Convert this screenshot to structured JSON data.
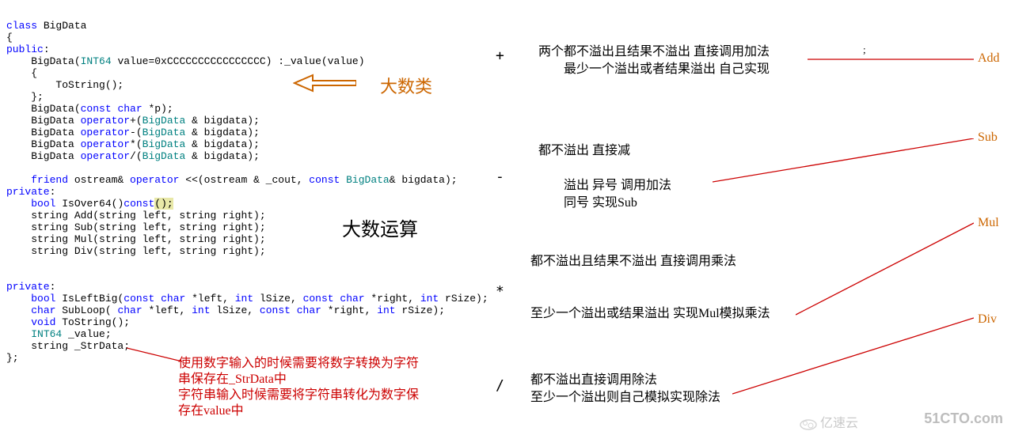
{
  "code": {
    "t01": "class",
    "t02": " BigData",
    "t03": "{",
    "t04": "public",
    "t05": ":",
    "t06": "    BigData(",
    "t07": "INT64",
    "t08": " value=0xCCCCCCCCCCCCCCCC) :_value(value)",
    "t09": "    {",
    "t10": "        ToString();",
    "t11": "    };",
    "t12": "    BigData(",
    "t13": "const",
    "t14": " ",
    "t15": "char",
    "t16": " *p);",
    "t17": "    BigData ",
    "t18": "operator",
    "t19": "+(",
    "t20": "BigData",
    "t21": " & bigdata);",
    "t22": "    BigData ",
    "t23": "operator",
    "t24": "-(",
    "t25": "BigData",
    "t26": " & bigdata);",
    "t27": "    BigData ",
    "t28": "operator",
    "t29": "*(",
    "t30": "BigData",
    "t31": " & bigdata);",
    "t32": "    BigData ",
    "t33": "operator",
    "t34": "/(",
    "t35": "BigData",
    "t36": " & bigdata);",
    "t37": "    ",
    "t38": "friend",
    "t39": " ostream& ",
    "t40": "operator",
    "t41": " <<(ostream & _cout, ",
    "t42": "const",
    "t43": " ",
    "t44": "BigData",
    "t45": "& bigdata);",
    "t46": "private",
    "t47": ":",
    "t48": "    ",
    "t49": "bool",
    "t50": " IsOver64()",
    "t51": "const",
    "t52": "();",
    "t53": "    string Add(string left, string right);",
    "t54": "    string Sub(string left, string right);",
    "t55": "    string Mul(string left, string right);",
    "t56": "    string Div(string left, string right);",
    "t57": "private",
    "t58": ":",
    "t59": "    ",
    "t60": "bool",
    "t61": " IsLeftBig(",
    "t62": "const",
    "t63": " ",
    "t64": "char",
    "t65": " *left, ",
    "t66": "int",
    "t67": " lSize, ",
    "t68": "const",
    "t69": " ",
    "t70": "char",
    "t71": " *right, ",
    "t72": "int",
    "t73": " rSize);",
    "t74": "    ",
    "t75": "char",
    "t76": " SubLoop( ",
    "t77": "char",
    "t78": " *left, ",
    "t79": "int",
    "t80": " lSize, ",
    "t81": "const",
    "t82": " ",
    "t83": "char",
    "t84": " *right, ",
    "t85": "int",
    "t86": " rSize);",
    "t87": "    ",
    "t88": "void",
    "t89": " ToString();",
    "t90": "    ",
    "t91": "INT64",
    "t92": " _value;",
    "t93": "    string _StrData;",
    "t94": "};"
  },
  "labels": {
    "bigclass": "大数类",
    "bigcalc": "大数运算"
  },
  "annotation": {
    "line1": "使用数字输入的时候需要将数字转换为字符",
    "line2": "串保存在_StrData中",
    "line3": "字符串输入时候需要将字符串转化为数字保",
    "line4": "存在value中"
  },
  "ops": {
    "add": {
      "sym": "+",
      "name": "Add",
      "l1": "两个都不溢出且结果不溢出    直接调用加法",
      "l2": "最少一个溢出或者结果溢出    自己实现"
    },
    "sub": {
      "sym": "-",
      "name": "Sub",
      "l1": "都不溢出    直接减",
      "l2": "溢出    异号    调用加法",
      "l3": "         同号    实现Sub"
    },
    "mul": {
      "sym": "*",
      "name": "Mul",
      "l1": "都不溢出且结果不溢出    直接调用乘法",
      "l2": "至少一个溢出或结果溢出    实现Mul模拟乘法"
    },
    "div": {
      "sym": "/",
      "name": "Div",
      "l1": "都不溢出直接调用除法",
      "l2": "至少一个溢出则自己模拟实现除法"
    }
  },
  "semicolon": ";",
  "wm1": "51CTO.com",
  "wm2": "亿速云"
}
